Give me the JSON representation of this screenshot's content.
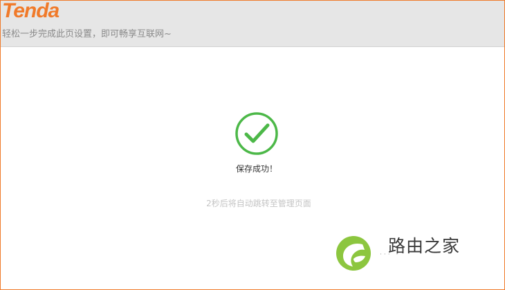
{
  "header": {
    "logo_text": "Tenda",
    "tagline": "轻松一步完成此页设置，即可畅享互联网~"
  },
  "status": {
    "success_message": "保存成功！",
    "redirect_message": "2秒后将自动跳转至管理页面"
  },
  "watermark": {
    "text": "路由之家"
  },
  "icons": {
    "success": "check-circle-icon",
    "watermark": "leaf-logo-icon"
  },
  "colors": {
    "brand": "#f07a2a",
    "success": "#4cb848",
    "header_bg": "#e6e6e6",
    "watermark_green": "#8cc63f"
  }
}
